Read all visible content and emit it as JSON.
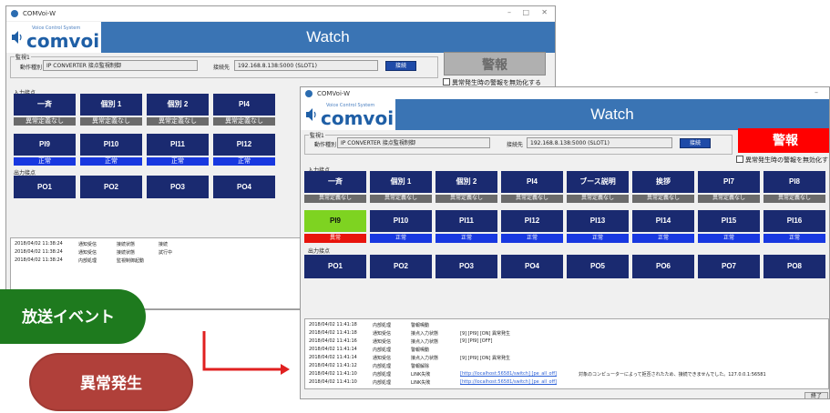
{
  "back_window": {
    "title": "COMVoi-W",
    "header_title": "Watch",
    "brand": "comvoi",
    "brand_tag": "Voice Control System",
    "monitor_legend": "監視1",
    "op_type_label": "動作種別",
    "op_type_value": "IP CONVERTER 接点監視制御",
    "connect_label": "接続先",
    "connect_value": "192.168.8.138:5000 (SLOT1)",
    "connect_button": "接続",
    "alarm_label": "警報",
    "disable_alarm_label": "異常発生時の警報を無効化する",
    "input_section": "入力接点",
    "output_section": "出力接点",
    "inputs_row1": [
      {
        "name": "一斉",
        "status": "異常定義なし"
      },
      {
        "name": "個別 1",
        "status": "異常定義なし"
      },
      {
        "name": "個別 2",
        "status": "異常定義なし"
      },
      {
        "name": "PI4",
        "status": "異常定義なし"
      }
    ],
    "inputs_row2": [
      {
        "name": "PI9",
        "status": "正常"
      },
      {
        "name": "PI10",
        "status": "正常"
      },
      {
        "name": "PI11",
        "status": "正常"
      },
      {
        "name": "PI12",
        "status": "正常"
      }
    ],
    "outputs": [
      "PO1",
      "PO2",
      "PO3",
      "PO4"
    ],
    "log": [
      [
        "2018/04/02 11:38:24",
        "通知受信",
        "接続状態",
        "接続"
      ],
      [
        "2018/04/02 11:38:24",
        "通知受信",
        "接続状態",
        "試行中"
      ],
      [
        "2018/04/02 11:38:24",
        "内部処理",
        "監視制御起動",
        ""
      ]
    ]
  },
  "front_window": {
    "title": "COMVoi-W",
    "header_title": "Watch",
    "brand": "comvoi",
    "brand_tag": "Voice Control System",
    "monitor_legend": "監視1",
    "op_type_label": "動作種別",
    "op_type_value": "IP CONVERTER 接点監視制御",
    "connect_label": "接続先",
    "connect_value": "192.168.8.138:5000 (SLOT1)",
    "connect_button": "接続",
    "alarm_label": "警報",
    "alarm_color": "#ff0000",
    "disable_alarm_label": "異常発生時の警報を無効化する",
    "input_section": "入力接点",
    "output_section": "出力接点",
    "inputs_row1": [
      {
        "name": "一斉",
        "status": "異常定義なし"
      },
      {
        "name": "個別 1",
        "status": "異常定義なし"
      },
      {
        "name": "個別 2",
        "status": "異常定義なし"
      },
      {
        "name": "PI4",
        "status": "異常定義なし"
      },
      {
        "name": "ブース説明",
        "status": "異常定義なし"
      },
      {
        "name": "挨拶",
        "status": "異常定義なし"
      },
      {
        "name": "PI7",
        "status": "異常定義なし"
      },
      {
        "name": "PI8",
        "status": "異常定義なし"
      }
    ],
    "inputs_row2": [
      {
        "name": "PI9",
        "status": "異常",
        "alert": true
      },
      {
        "name": "PI10",
        "status": "正常"
      },
      {
        "name": "PI11",
        "status": "正常"
      },
      {
        "name": "PI12",
        "status": "正常"
      },
      {
        "name": "PI13",
        "status": "正常"
      },
      {
        "name": "PI14",
        "status": "正常"
      },
      {
        "name": "PI15",
        "status": "正常"
      },
      {
        "name": "PI16",
        "status": "正常"
      }
    ],
    "outputs": [
      "PO1",
      "PO2",
      "PO3",
      "PO4",
      "PO5",
      "PO6",
      "PO7",
      "PO8"
    ],
    "log": [
      [
        "2018/04/02 11:41:18",
        "内部処理",
        "警報鳴動",
        "",
        ""
      ],
      [
        "2018/04/02 11:41:18",
        "通知受信",
        "接点入力状態",
        "[9]   [PI9]   [ON]   異常発生",
        ""
      ],
      [
        "2018/04/02 11:41:16",
        "通知受信",
        "接点入力状態",
        "[9]   [PI9]   [OFF]",
        ""
      ],
      [
        "2018/04/02 11:41:14",
        "内部処理",
        "警報鳴動",
        "",
        ""
      ],
      [
        "2018/04/02 11:41:14",
        "通知受信",
        "接点入力状態",
        "[9]   [PI9]   [ON]   異常発生",
        ""
      ],
      [
        "2018/04/02 11:41:12",
        "内部処理",
        "警報解除",
        "",
        ""
      ],
      [
        "2018/04/02 11:41:10",
        "内部処理",
        "LINK失敗",
        "[http://localhost:56581/switch]  [pe_all_off]",
        "対象のコンピューターによって拒否されたため、接続できませんでした。127.0.0.1:56581"
      ],
      [
        "2018/04/02 11:41:10",
        "内部処理",
        "LINK失敗",
        "[http://localhost:56581/switch]  [pe_all_off]",
        ""
      ]
    ],
    "end_button": "終了"
  },
  "callouts": {
    "broadcast_event": "放送イベント",
    "broadcast_color": "#1e7a1e",
    "anomaly": "異常発生",
    "anomaly_color": "#b0403a",
    "arrow_color": "#e02020"
  }
}
